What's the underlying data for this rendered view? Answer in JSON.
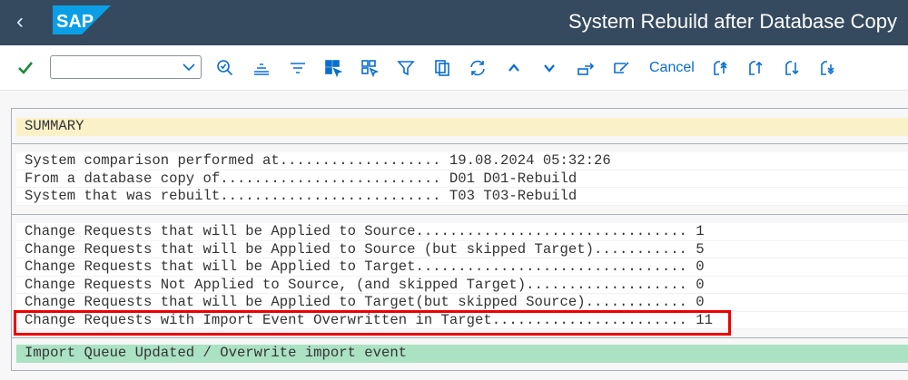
{
  "header": {
    "title": "System Rebuild after Database Copy",
    "logo": "SAP",
    "back_icon": "chevron-left-icon"
  },
  "toolbar": {
    "command_field": {
      "value": "",
      "placeholder": ""
    },
    "cancel_label": "Cancel",
    "icons": [
      "check-icon",
      "find-icon",
      "sort-ascending-icon",
      "sort-descending-icon",
      "select-all-icon",
      "deselect-all-icon",
      "filter-icon",
      "copy-icon",
      "refresh-icon",
      "page-up-icon",
      "page-down-icon",
      "export-icon",
      "edit-icon",
      "cancel",
      "first-page-icon",
      "previous-page-icon",
      "next-page-icon",
      "last-page-icon"
    ],
    "accent": "#0a6ed1"
  },
  "summary": {
    "heading": "SUMMARY"
  },
  "info_rows": [
    {
      "label": "System comparison performed at",
      "value": "19.08.2024 05:32:26"
    },
    {
      "label": "From a database copy of",
      "value": "D01 D01-Rebuild"
    },
    {
      "label": "System that was rebuilt",
      "value": "T03 T03-Rebuild"
    }
  ],
  "count_rows": [
    {
      "label": "Change Requests that will be Applied to Source",
      "value": "1"
    },
    {
      "label": "Change Requests that will be Applied to Source (but skipped Target)",
      "value": "5"
    },
    {
      "label": "Change Requests that will be Applied to Target",
      "value": "0"
    },
    {
      "label": "Change Requests Not Applied to Source, (and skipped Target)",
      "value": "0"
    },
    {
      "label": "Change Requests that will be Applied to Target(but skipped Source)",
      "value": "0"
    },
    {
      "label": "Change Requests with Import Event Overwritten in Target",
      "value": "11"
    }
  ],
  "status": {
    "message": "Import Queue Updated / Overwrite import event"
  },
  "colors": {
    "header_bg": "#354a5f",
    "summary_bg": "#fbf1c9",
    "status_bg": "#abe2c4",
    "highlight": "#ee0000"
  }
}
